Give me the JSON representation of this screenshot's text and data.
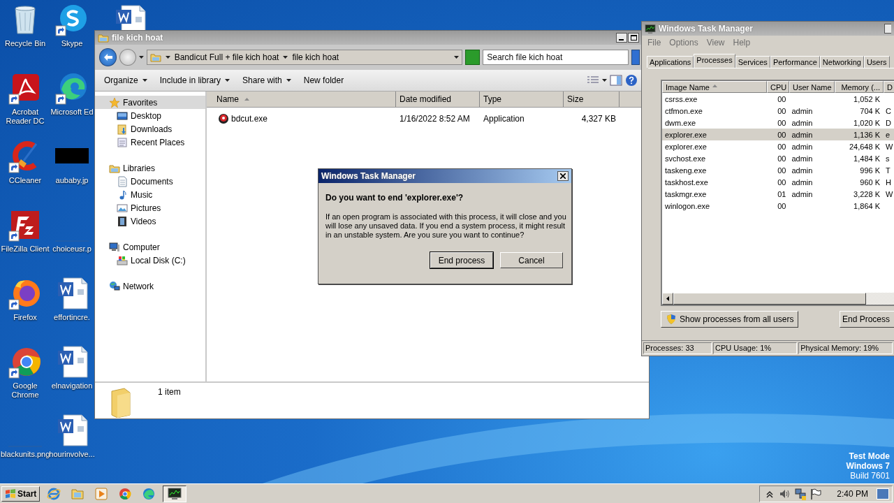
{
  "desktop_icons": [
    {
      "label": "Recycle Bin",
      "kind": "recycle",
      "shortcut": false
    },
    {
      "label": "Skype",
      "kind": "skype",
      "shortcut": true
    },
    {
      "label": "Acrobat Reader DC",
      "kind": "acrobat",
      "shortcut": true
    },
    {
      "label": "Microsoft Ed",
      "kind": "edge",
      "shortcut": true
    },
    {
      "label": "CCleaner",
      "kind": "ccleaner",
      "shortcut": true
    },
    {
      "label": "aubaby.jp",
      "kind": "black-image",
      "shortcut": false
    },
    {
      "label": "FileZilla Client",
      "kind": "filezilla",
      "shortcut": true
    },
    {
      "label": "choiceusr.p",
      "kind": "blank-image",
      "shortcut": false
    },
    {
      "label": "Firefox",
      "kind": "firefox",
      "shortcut": true
    },
    {
      "label": "effortincre.",
      "kind": "word",
      "shortcut": false
    },
    {
      "label": "Google Chrome",
      "kind": "chrome",
      "shortcut": true
    },
    {
      "label": "elnavigation",
      "kind": "word",
      "shortcut": false
    },
    {
      "label": "blackunits.png",
      "kind": "blank-image",
      "shortcut": false
    },
    {
      "label": "hourinvolve...",
      "kind": "word",
      "shortcut": false
    }
  ],
  "explorer": {
    "title": "file kich hoat",
    "breadcrumb": [
      "Bandicut Full + file kich hoat",
      "file kich hoat"
    ],
    "search": {
      "placeholder": "Search file kich hoat"
    },
    "toolbar": [
      {
        "label": "Organize",
        "dropdown": true
      },
      {
        "label": "Include in library",
        "dropdown": true
      },
      {
        "label": "Share with",
        "dropdown": true
      },
      {
        "label": "New folder",
        "dropdown": false
      }
    ],
    "nav": [
      {
        "label": "Favorites",
        "kind": "star",
        "selected": true,
        "children": [
          {
            "label": "Desktop",
            "kind": "desktop",
            "selected": false
          },
          {
            "label": "Downloads",
            "kind": "downloads",
            "selected": false
          },
          {
            "label": "Recent Places",
            "kind": "recent",
            "selected": false
          }
        ]
      },
      {
        "label": "Libraries",
        "kind": "library",
        "selected": false,
        "children": [
          {
            "label": "Documents",
            "kind": "documents",
            "selected": false
          },
          {
            "label": "Music",
            "kind": "music",
            "selected": false
          },
          {
            "label": "Pictures",
            "kind": "pictures",
            "selected": false
          },
          {
            "label": "Videos",
            "kind": "videos",
            "selected": false
          }
        ]
      },
      {
        "label": "Computer",
        "kind": "computer",
        "selected": false,
        "children": [
          {
            "label": "Local Disk (C:)",
            "kind": "disk",
            "selected": false
          }
        ]
      },
      {
        "label": "Network",
        "kind": "network",
        "selected": false
      }
    ],
    "columns": [
      {
        "label": "Name",
        "sorted": true
      },
      {
        "label": "Date modified",
        "sorted": false
      },
      {
        "label": "Type",
        "sorted": false
      },
      {
        "label": "Size",
        "sorted": false
      }
    ],
    "files": [
      {
        "name": "bdcut.exe",
        "date": "1/16/2022 8:52 AM",
        "type": "Application",
        "size": "4,327 KB"
      }
    ],
    "status": "1 item"
  },
  "dialog": {
    "title": "Windows Task Manager",
    "question": "Do you want to end 'explorer.exe'?",
    "message": "If an open program is associated with this process, it will close and you will lose any unsaved data. If you end a system process, it might result in an unstable system. Are you sure you want to continue?",
    "buttons": [
      {
        "label": "End process",
        "default": true
      },
      {
        "label": "Cancel",
        "default": false
      }
    ]
  },
  "task_manager": {
    "title": "Windows Task Manager",
    "menu": [
      "File",
      "Options",
      "View",
      "Help"
    ],
    "tabs": [
      {
        "label": "Applications",
        "selected": false
      },
      {
        "label": "Processes",
        "selected": true
      },
      {
        "label": "Services",
        "selected": false
      },
      {
        "label": "Performance",
        "selected": false
      },
      {
        "label": "Networking",
        "selected": false
      },
      {
        "label": "Users",
        "selected": false
      }
    ],
    "columns": [
      {
        "label": "Image Name",
        "sorted": true
      },
      {
        "label": "CPU",
        "sorted": false
      },
      {
        "label": "User Name",
        "sorted": false
      },
      {
        "label": "Memory (...",
        "sorted": false
      },
      {
        "label": "D",
        "sorted": false
      }
    ],
    "rows": [
      {
        "image": "csrss.exe",
        "cpu": "00",
        "memory": "1,052 K",
        "selected": false
      },
      {
        "image": "ctfmon.exe",
        "cpu": "00",
        "user": "admin",
        "memory": "704 K",
        "column_5": "C",
        "selected": false
      },
      {
        "image": "dwm.exe",
        "cpu": "00",
        "user": "admin",
        "memory": "1,020 K",
        "column_5": "D",
        "selected": false
      },
      {
        "image": "explorer.exe",
        "cpu": "00",
        "user": "admin",
        "memory": "1,136 K",
        "column_5": "e",
        "selected": true
      },
      {
        "image": "explorer.exe",
        "cpu": "00",
        "user": "admin",
        "memory": "24,648 K",
        "column_5": "W",
        "selected": false
      },
      {
        "image": "svchost.exe",
        "cpu": "00",
        "user": "admin",
        "memory": "1,484 K",
        "column_5": "s",
        "selected": false
      },
      {
        "image": "taskeng.exe",
        "cpu": "00",
        "user": "admin",
        "memory": "996 K",
        "column_5": "T",
        "selected": false
      },
      {
        "image": "taskhost.exe",
        "cpu": "00",
        "user": "admin",
        "memory": "960 K",
        "column_5": "H",
        "selected": false
      },
      {
        "image": "taskmgr.exe",
        "cpu": "01",
        "user": "admin",
        "memory": "3,228 K",
        "column_5": "W",
        "selected": false
      },
      {
        "image": "winlogon.exe",
        "cpu": "00",
        "memory": "1,864 K",
        "selected": false
      }
    ],
    "buttons": [
      {
        "label": "Show processes from all users",
        "kind": "shield"
      },
      {
        "label": "End Process",
        "kind": "plain"
      }
    ],
    "status": [
      "Processes: 33",
      "CPU Usage: 1%",
      "Physical Memory: 19%"
    ]
  },
  "taskbar": {
    "start": "Start",
    "apps": [
      {
        "kind": "ie",
        "active": false
      },
      {
        "kind": "folder",
        "active": false
      },
      {
        "kind": "media",
        "active": false
      },
      {
        "kind": "chrome",
        "active": false
      },
      {
        "kind": "edge",
        "active": false
      },
      {
        "kind": "taskmgr",
        "active": true
      }
    ],
    "tray": [
      {
        "kind": "chevron"
      },
      {
        "kind": "speaker"
      },
      {
        "kind": "network"
      },
      {
        "kind": "flag"
      }
    ],
    "clock": "2:40 PM"
  },
  "desktop_notice": [
    "Test Mode",
    "Windows 7",
    "Build 7601"
  ]
}
